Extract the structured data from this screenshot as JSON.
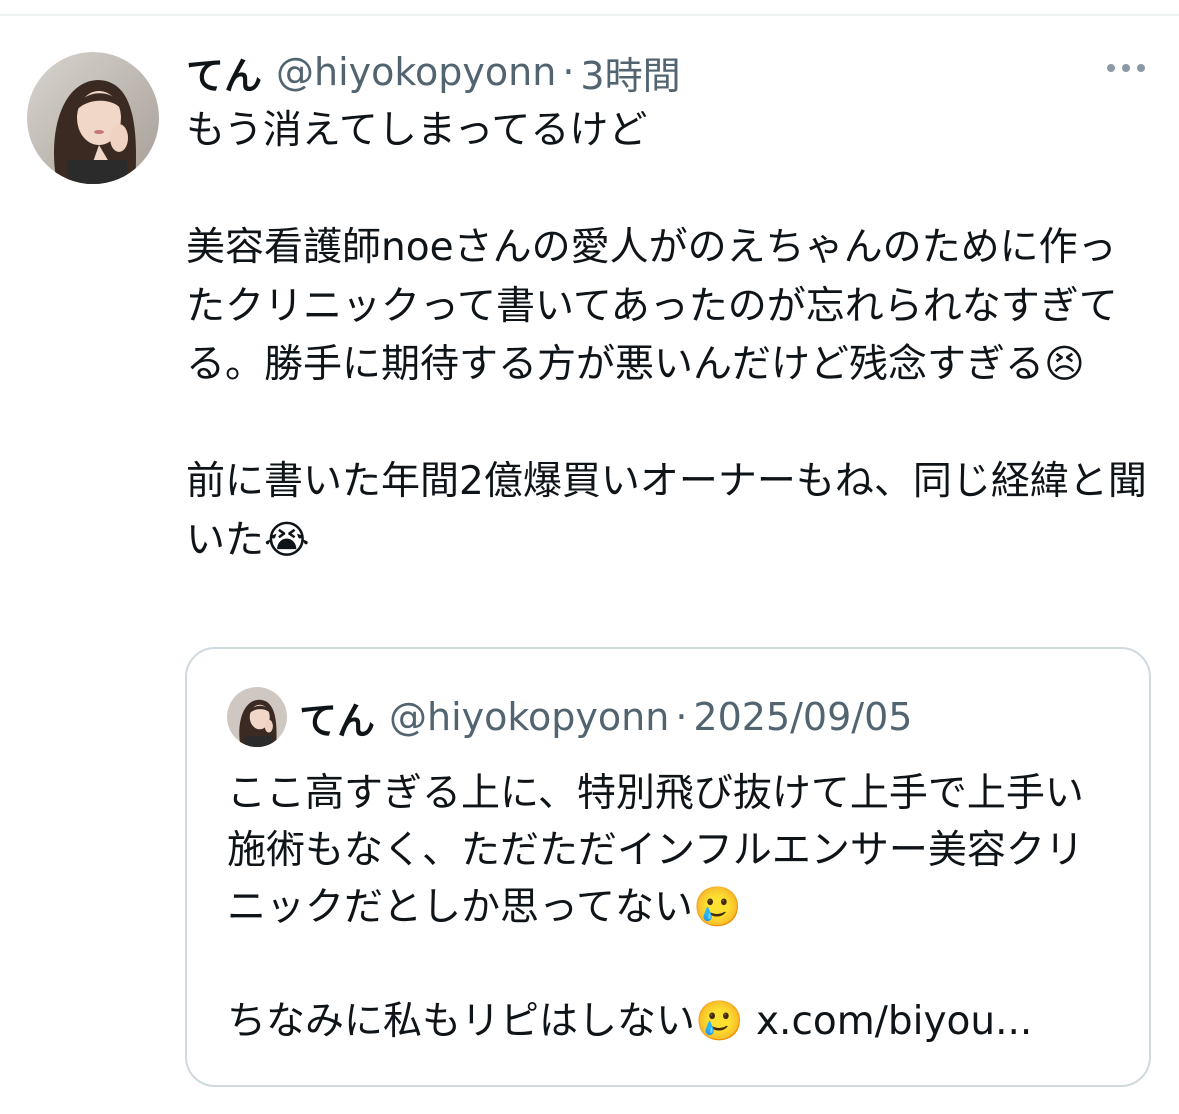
{
  "tweet": {
    "author_name": "てん",
    "handle": "@hiyokopyonn",
    "separator": "·",
    "time": "3時間",
    "avatar_icon": "profile-photo",
    "more_icon": "more-dots-icon",
    "text": "もう消えてしまってるけど\n\n美容看護師noeさんの愛人がのえちゃんのために作ったクリニックって書いてあったのが忘れられなすぎてる。勝手に期待する方が悪いんだけど残念すぎる😣\n\n前に書いた年間2億爆買いオーナーもね、同じ経緯と聞いた😭"
  },
  "quote": {
    "author_name": "てん",
    "handle": "@hiyokopyonn",
    "separator": "·",
    "date": "2025/09/05",
    "text": "ここ高すぎる上に、特別飛び抜けて上手で上手い施術もなく、ただただインフルエンサー美容クリニックだとしか思ってない🥲\n\nちなみに私もリピはしない🥲 ",
    "link_text": "x.com/biyou..."
  },
  "colors": {
    "text_primary": "#0f1419",
    "text_secondary": "#536471",
    "border": "#cfd9de"
  }
}
